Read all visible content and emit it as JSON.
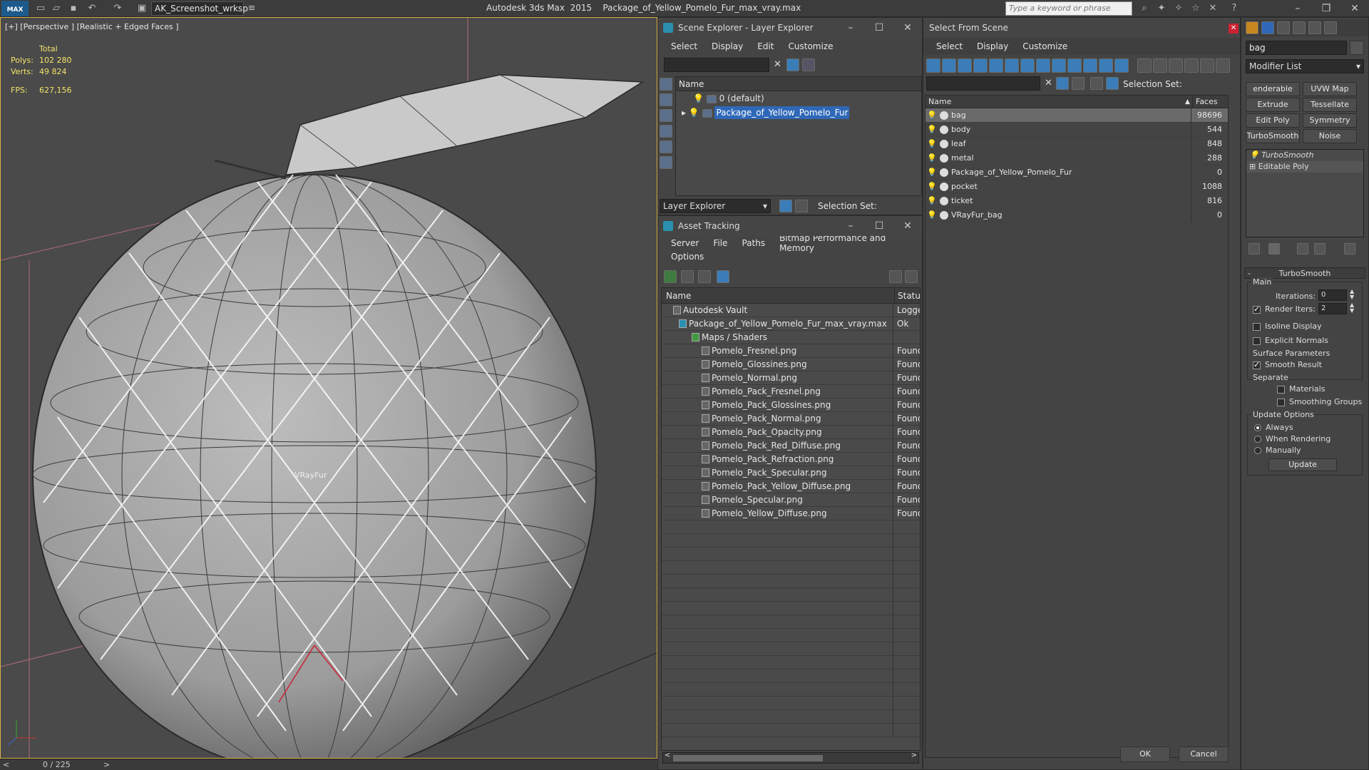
{
  "titlebar": {
    "logo": "MAX",
    "workspace": "AK_Screenshot_wrksp",
    "title": "Autodesk 3ds Max  2015    Package_of_Yellow_Pomelo_Fur_max_vray.max",
    "search_placeholder": "Type a keyword or phrase"
  },
  "viewport": {
    "label": "[+] [Perspective ] [Realistic + Edged Faces ]",
    "stats": {
      "total_label": "Total",
      "polys_label": "Polys:",
      "polys_value": "102 280",
      "verts_label": "Verts:",
      "verts_value": "49 824",
      "fps_label": "FPS:",
      "fps_value": "627,156"
    },
    "object_label": "VRayFur",
    "timeline": "0 / 225"
  },
  "layer_explorer": {
    "title": "Scene Explorer - Layer Explorer",
    "menu": [
      "Select",
      "Display",
      "Edit",
      "Customize"
    ],
    "column": "Name",
    "rows": [
      {
        "name": "0 (default)",
        "selected": false
      },
      {
        "name": "Package_of_Yellow_Pomelo_Fur",
        "selected": true
      }
    ],
    "footer_dropdown": "Layer Explorer",
    "selection_set_label": "Selection Set:"
  },
  "asset_tracking": {
    "title": "Asset Tracking",
    "menu1": [
      "Server",
      "File",
      "Paths",
      "Bitmap Performance and Memory"
    ],
    "menu2": [
      "Options"
    ],
    "col_name": "Name",
    "col_status": "Status",
    "rows": [
      {
        "name": "Autodesk Vault",
        "status": "Logged",
        "level": 1
      },
      {
        "name": "Package_of_Yellow_Pomelo_Fur_max_vray.max",
        "status": "Ok",
        "level": 2
      },
      {
        "name": "Maps / Shaders",
        "status": "",
        "level": 3
      },
      {
        "name": "Pomelo_Fresnel.png",
        "status": "Found",
        "level": 4
      },
      {
        "name": "Pomelo_Glossines.png",
        "status": "Found",
        "level": 4
      },
      {
        "name": "Pomelo_Normal.png",
        "status": "Found",
        "level": 4
      },
      {
        "name": "Pomelo_Pack_Fresnel.png",
        "status": "Found",
        "level": 4
      },
      {
        "name": "Pomelo_Pack_Glossines.png",
        "status": "Found",
        "level": 4
      },
      {
        "name": "Pomelo_Pack_Normal.png",
        "status": "Found",
        "level": 4
      },
      {
        "name": "Pomelo_Pack_Opacity.png",
        "status": "Found",
        "level": 4
      },
      {
        "name": "Pomelo_Pack_Red_Diffuse.png",
        "status": "Found",
        "level": 4
      },
      {
        "name": "Pomelo_Pack_Refraction.png",
        "status": "Found",
        "level": 4
      },
      {
        "name": "Pomelo_Pack_Specular.png",
        "status": "Found",
        "level": 4
      },
      {
        "name": "Pomelo_Pack_Yellow_Diffuse.png",
        "status": "Found",
        "level": 4
      },
      {
        "name": "Pomelo_Specular.png",
        "status": "Found",
        "level": 4
      },
      {
        "name": "Pomelo_Yellow_Diffuse.png",
        "status": "Found",
        "level": 4
      }
    ]
  },
  "select_from_scene": {
    "title": "Select From Scene",
    "menu": [
      "Select",
      "Display",
      "Customize"
    ],
    "selection_set_label": "Selection Set:",
    "col_name": "Name",
    "col_faces": "Faces",
    "rows": [
      {
        "name": "bag",
        "faces": "98696",
        "selected": true
      },
      {
        "name": "body",
        "faces": "544",
        "selected": false
      },
      {
        "name": "leaf",
        "faces": "848",
        "selected": false
      },
      {
        "name": "metal",
        "faces": "288",
        "selected": false
      },
      {
        "name": "Package_of_Yellow_Pomelo_Fur",
        "faces": "0",
        "selected": false
      },
      {
        "name": "pocket",
        "faces": "1088",
        "selected": false
      },
      {
        "name": "ticket",
        "faces": "816",
        "selected": false
      },
      {
        "name": "VRayFur_bag",
        "faces": "0",
        "selected": false
      }
    ],
    "ok": "OK",
    "cancel": "Cancel"
  },
  "command_panel": {
    "object_name": "bag",
    "modifier_list": "Modifier List",
    "buttons": [
      "enderable Spli",
      "UVW Map",
      "Extrude",
      "Tessellate",
      "Edit Poly",
      "Symmetry",
      "TurboSmooth",
      "Noise"
    ],
    "stack": [
      "TurboSmooth",
      "Editable Poly"
    ],
    "rollout_title": "TurboSmooth",
    "main_label": "Main",
    "iterations_label": "Iterations:",
    "iterations_value": "0",
    "render_iters_label": "Render Iters:",
    "render_iters_value": "2",
    "isoline_label": "Isoline Display",
    "explicit_normals_label": "Explicit Normals",
    "surface_params_label": "Surface Parameters",
    "smooth_result_label": "Smooth Result",
    "separate_label": "Separate",
    "materials_label": "Materials",
    "smoothing_groups_label": "Smoothing Groups",
    "update_options_label": "Update Options",
    "always_label": "Always",
    "when_rendering_label": "When Rendering",
    "manually_label": "Manually",
    "update_button": "Update"
  }
}
